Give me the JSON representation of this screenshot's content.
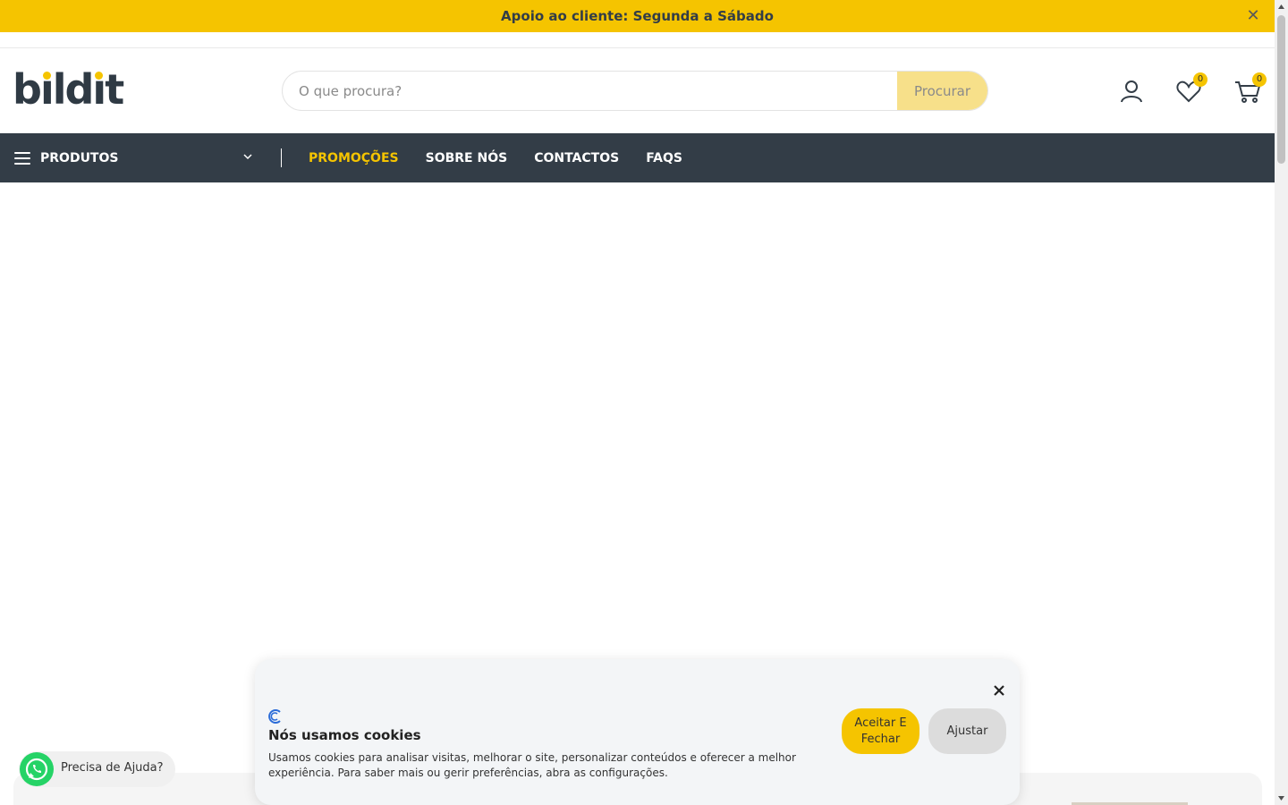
{
  "topbar": {
    "text": "Apoio ao cliente: Segunda a Sábado",
    "close_icon": "close-icon"
  },
  "header": {
    "logo_text": "bildit",
    "search": {
      "placeholder": "O que procura?",
      "value": "",
      "button_label": "Procurar"
    },
    "wishlist_count": "0",
    "cart_count": "0"
  },
  "nav": {
    "products_label": "PRODUTOS",
    "links": [
      {
        "label": "PROMOÇÕES",
        "active": true
      },
      {
        "label": "SOBRE NÓS",
        "active": false
      },
      {
        "label": "CONTACTOS",
        "active": false
      },
      {
        "label": "FAQS",
        "active": false
      }
    ]
  },
  "whatsapp": {
    "label": "Precisa de Ajuda?"
  },
  "cookie": {
    "title": "Nós usamos cookies",
    "text": "Usamos cookies para analisar visitas, melhorar o site, personalizar conteúdos e oferecer a melhor experiência. Para saber mais ou gerir preferências, abra as configurações.",
    "accept_label": "Aceitar E Fechar",
    "adjust_label": "Ajustar"
  },
  "colors": {
    "brand_yellow": "#f5c400",
    "nav_bg": "#333d47",
    "whatsapp_green": "#25d366"
  }
}
